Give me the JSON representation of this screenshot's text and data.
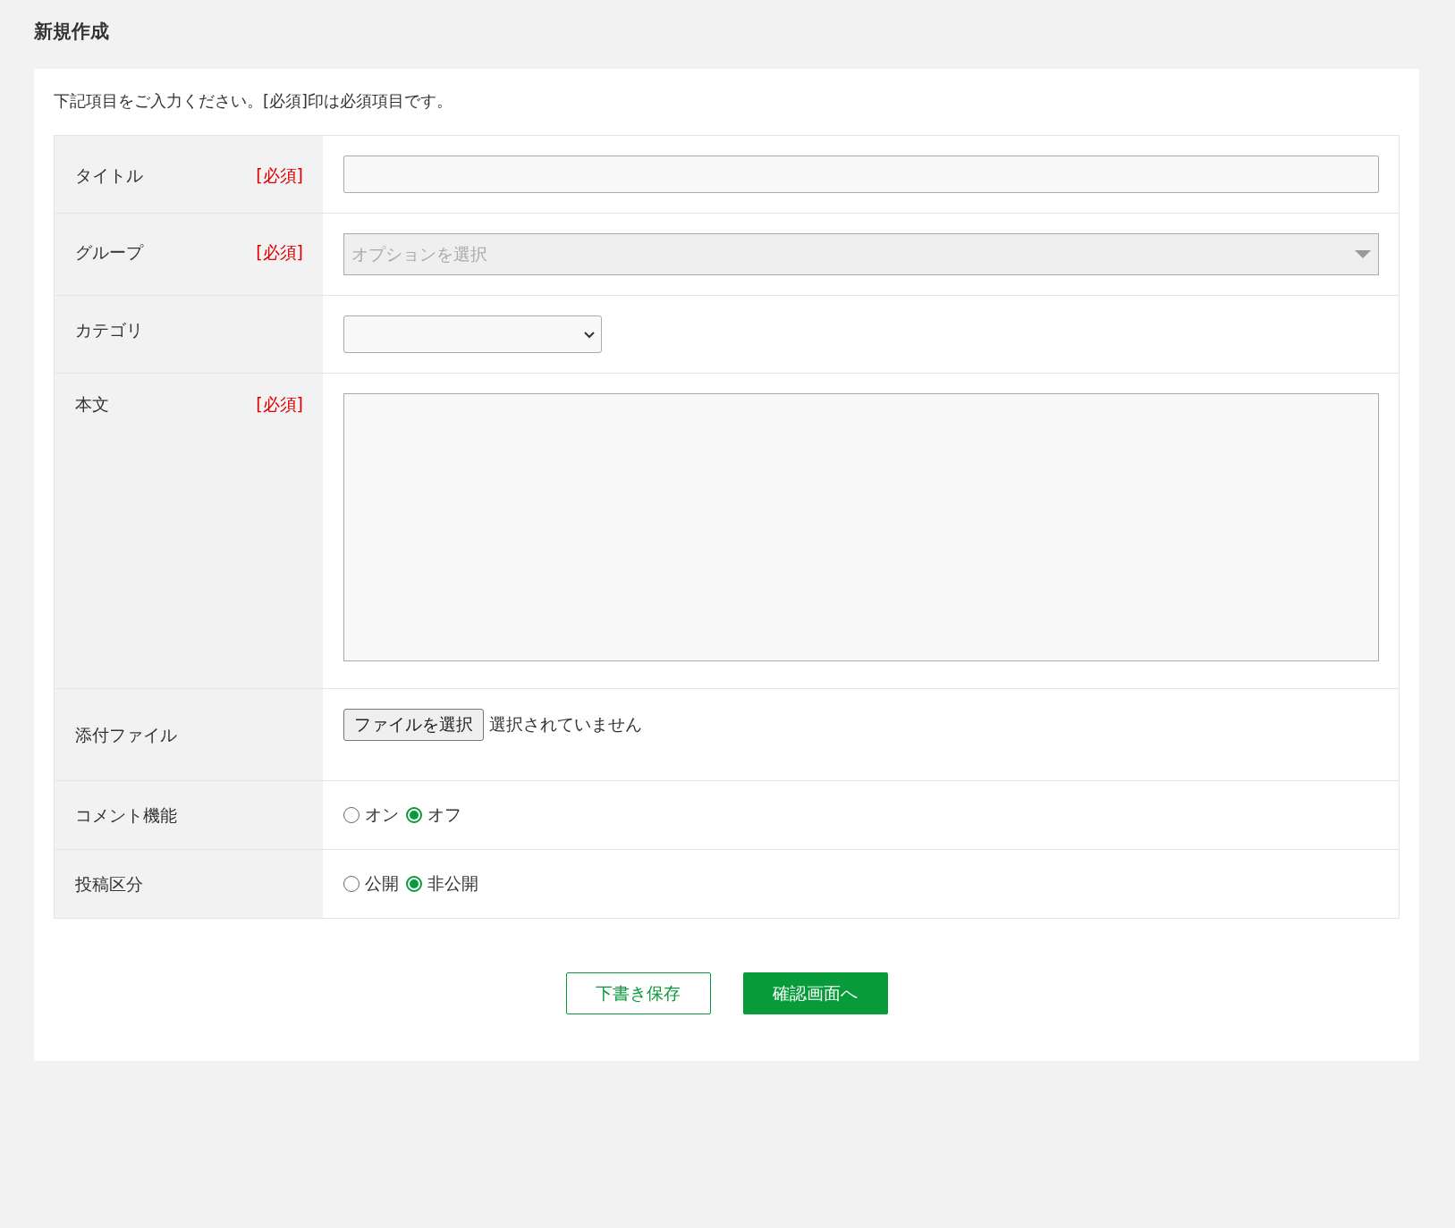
{
  "page_title": "新規作成",
  "intro": "下記項目をご入力ください。[必須]印は必須項目です。",
  "rows": [
    {
      "kind": "text",
      "label": "タイトル",
      "badge": "[必須]"
    },
    {
      "kind": "combo",
      "label": "グループ",
      "badge": "[必須]",
      "placeholder": "オプションを選択"
    },
    {
      "kind": "select",
      "label": "カテゴリ"
    },
    {
      "kind": "textarea",
      "label": "本文",
      "badge": "[必須]"
    },
    {
      "kind": "file",
      "label": "添付ファイル",
      "button": "ファイルを選択",
      "status": "選択されていません"
    },
    {
      "kind": "radio",
      "label": "コメント機能",
      "options": [
        {
          "label": "オン",
          "selected": false
        },
        {
          "label": "オフ",
          "selected": true
        }
      ]
    },
    {
      "kind": "radio",
      "label": "投稿区分",
      "options": [
        {
          "label": "公開",
          "selected": false
        },
        {
          "label": "非公開",
          "selected": true
        }
      ]
    }
  ],
  "buttons": [
    {
      "kind": "outline",
      "label": "下書き保存"
    },
    {
      "kind": "primary",
      "label": "確認画面へ"
    }
  ]
}
